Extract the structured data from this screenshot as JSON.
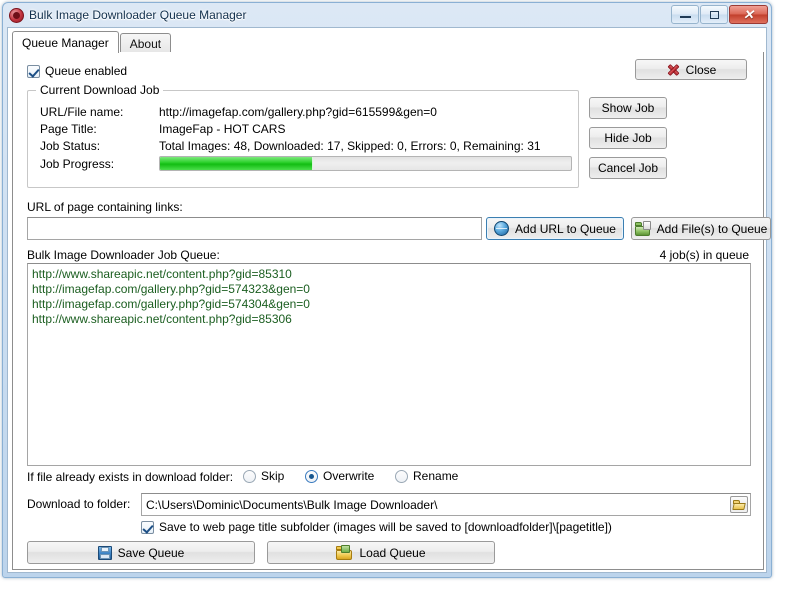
{
  "window": {
    "title": "Bulk Image Downloader Queue Manager",
    "icon": "app-icon",
    "controls": {
      "minimize": "minimize-icon",
      "maximize": "maximize-icon",
      "close": "close-icon"
    }
  },
  "tabs": [
    {
      "label": "Queue Manager",
      "active": true
    },
    {
      "label": "About",
      "active": false
    }
  ],
  "queue_enabled": {
    "label": "Queue enabled",
    "checked": true
  },
  "close_button": {
    "label": "Close",
    "icon": "red-x-icon"
  },
  "current_job": {
    "group_title": "Current Download Job",
    "fields": [
      {
        "label": "URL/File name:",
        "value": "http://imagefap.com/gallery.php?gid=615599&gen=0"
      },
      {
        "label": "Page Title:",
        "value": "ImageFap - HOT CARS"
      },
      {
        "label": "Job Status:",
        "value": "Total Images: 48, Downloaded: 17, Skipped: 0, Errors: 0, Remaining: 31"
      },
      {
        "label": "Job Progress:",
        "value": ""
      }
    ],
    "progress_percent": 37,
    "progress_color": "#12bd12",
    "buttons": [
      {
        "label": "Show Job"
      },
      {
        "label": "Hide Job"
      },
      {
        "label": "Cancel Job"
      }
    ]
  },
  "url_section": {
    "label": "URL of page containing links:",
    "input_value": "",
    "input_placeholder": "",
    "add_url_button": {
      "label": "Add URL to Queue",
      "icon": "globe-icon"
    },
    "add_files_button": {
      "label": "Add File(s) to Queue",
      "icon": "folder-add-icon"
    }
  },
  "queue_list": {
    "label": "Bulk Image Downloader Job Queue:",
    "count_label": "4 job(s) in queue",
    "items": [
      "http://www.shareapic.net/content.php?gid=85310",
      "http://imagefap.com/gallery.php?gid=574323&gen=0",
      "http://imagefap.com/gallery.php?gid=574304&gen=0",
      "http://www.shareapic.net/content.php?gid=85306"
    ]
  },
  "file_exists": {
    "label": "If file already exists in download folder:",
    "options": [
      {
        "label": "Skip",
        "selected": false
      },
      {
        "label": "Overwrite",
        "selected": true
      },
      {
        "label": "Rename",
        "selected": false
      }
    ]
  },
  "download_folder": {
    "label": "Download to folder:",
    "value": "C:\\Users\\Dominic\\Documents\\Bulk Image Downloader\\",
    "browse_icon": "open-folder-icon"
  },
  "subfolder_option": {
    "label": "Save to web page title subfolder (images will be saved to [downloadfolder]\\[pagetitle])",
    "checked": true
  },
  "bottom_buttons": [
    {
      "label": "Save Queue",
      "icon": "floppy-disk-icon"
    },
    {
      "label": "Load Queue",
      "icon": "folder-open-icon"
    }
  ]
}
